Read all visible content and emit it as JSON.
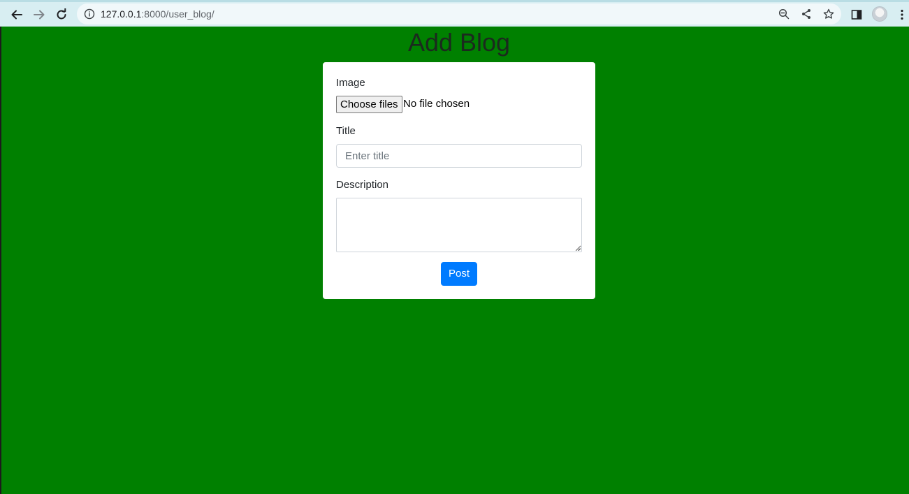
{
  "browser": {
    "url_host": "127.0.0.1",
    "url_path": ":8000/user_blog/",
    "icons": {
      "back": "arrow-left",
      "forward": "arrow-right",
      "reload": "reload",
      "site_info": "info-circle",
      "zoom": "magnifier-minus",
      "share": "share",
      "bookmark": "star-outline",
      "side_panel": "side-panel",
      "menu": "three-dots-vertical"
    },
    "colors": {
      "chrome_bg": "#d8eef2",
      "omnibox_bg": "#f1f8fa"
    }
  },
  "page": {
    "title": "Add Blog",
    "background_color": "#008000",
    "form": {
      "image_label": "Image",
      "file_button_label": "Choose files",
      "file_status": "No file chosen",
      "title_label": "Title",
      "title_placeholder": "Enter title",
      "title_value": "",
      "description_label": "Description",
      "description_value": "",
      "submit_label": "Post",
      "submit_color": "#007bff"
    }
  }
}
